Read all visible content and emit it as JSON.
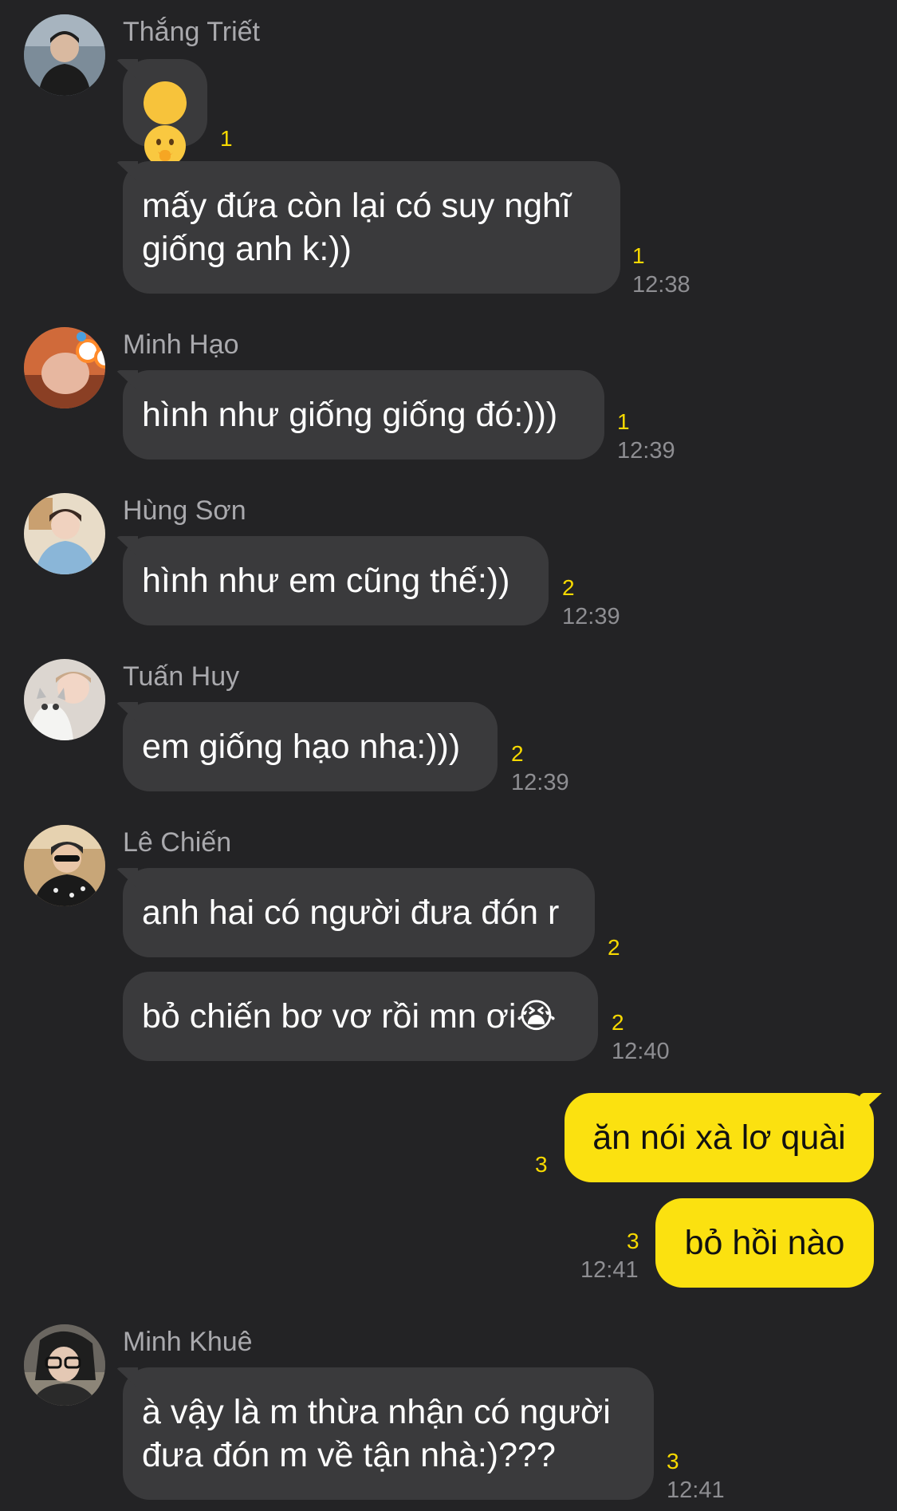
{
  "messages": [
    {
      "sender": "Thắng Triết",
      "bubbles": [
        {
          "text": "🤭",
          "unread": "1",
          "time": ""
        },
        {
          "text": "mấy đứa còn lại có suy nghĩ\ngiống anh k:))",
          "unread": "1",
          "time": "12:38"
        }
      ]
    },
    {
      "sender": "Minh Hạo",
      "bubbles": [
        {
          "text": "hình như giống giống đó:)))",
          "unread": "1",
          "time": "12:39"
        }
      ]
    },
    {
      "sender": "Hùng Sơn",
      "bubbles": [
        {
          "text": "hình như em cũng thế:))",
          "unread": "2",
          "time": "12:39"
        }
      ]
    },
    {
      "sender": "Tuấn Huy",
      "bubbles": [
        {
          "text": "em giống hạo nha:)))",
          "unread": "2",
          "time": "12:39"
        }
      ]
    },
    {
      "sender": "Lê Chiến",
      "bubbles": [
        {
          "text": "anh hai có người đưa đón r",
          "unread": "2",
          "time": ""
        },
        {
          "text": "bỏ chiến bơ vơ rồi mn ơi😭",
          "unread": "2",
          "time": "12:40"
        }
      ]
    },
    {
      "sender": "me",
      "bubbles": [
        {
          "text": "ăn nói xà lơ quài",
          "unread": "3",
          "time": ""
        },
        {
          "text": "bỏ hồi nào",
          "unread": "3",
          "time": "12:41"
        }
      ]
    },
    {
      "sender": "Minh Khuê",
      "bubbles": [
        {
          "text": "à vậy là m thừa nhận có người\nđưa đón m về tận nhà:)???",
          "unread": "3",
          "time": "12:41"
        }
      ]
    }
  ],
  "colors": {
    "background": "#232325",
    "incoming_bubble": "#3a3a3c",
    "outgoing_bubble": "#fbe110",
    "unread_count": "#f7d900",
    "timestamp": "#8e8e92"
  }
}
